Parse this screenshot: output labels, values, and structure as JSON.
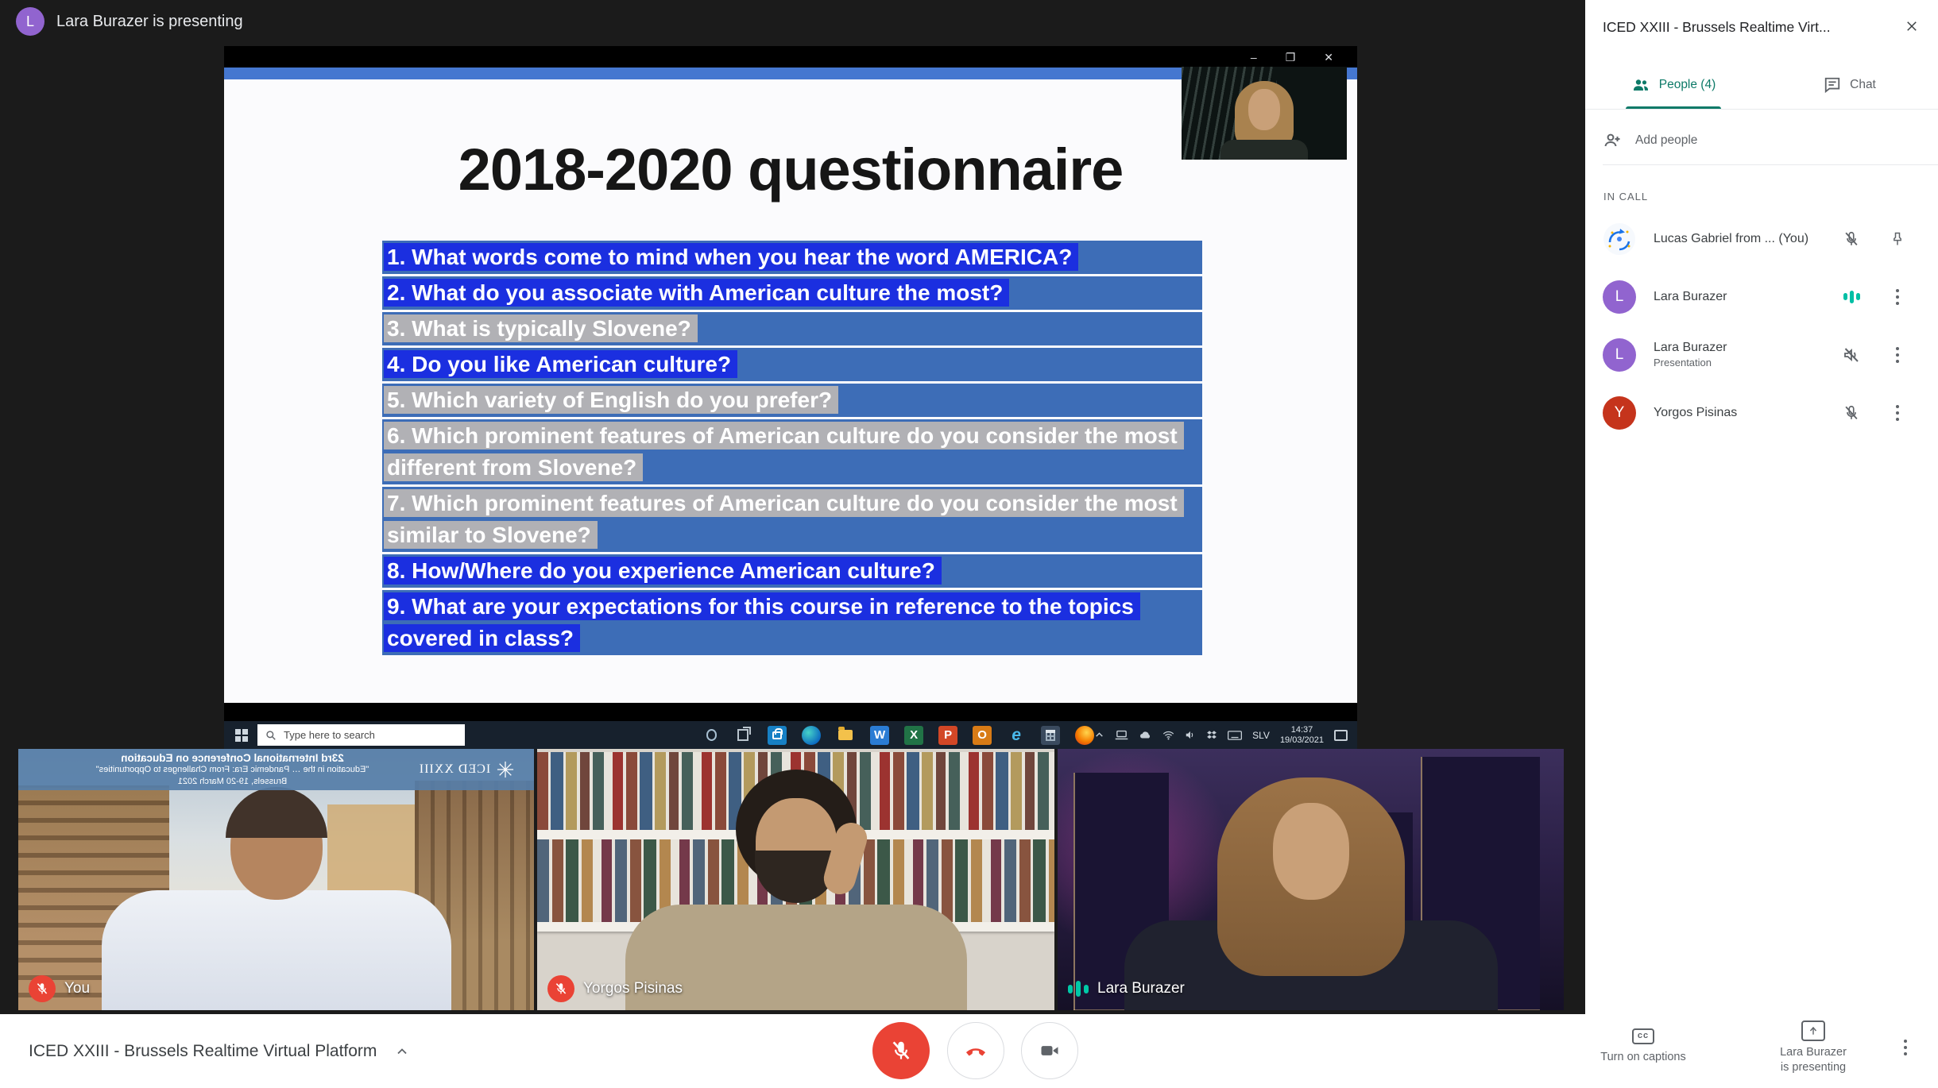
{
  "colors": {
    "meet_teal": "#0d7a68",
    "audio_green": "#00bfa5",
    "meet_red": "#ea4335",
    "avatar_purple": "#9164cf",
    "avatar_red": "#c5341c",
    "slide_bar_blue": "#4577d0",
    "question_base_blue": "#3d6db7",
    "highlight_blue": "#1b2fe0",
    "highlight_gray": "#b1b1b5"
  },
  "top_banner": {
    "avatar_initial": "L",
    "text": "Lara Burazer is presenting"
  },
  "presentation": {
    "window_controls": {
      "minimize": "–",
      "restore": "❐",
      "close": "✕"
    },
    "slide": {
      "title": "2018-2020 questionnaire",
      "questions": [
        {
          "text": "1. What words come to mind when you hear the word AMERICA?",
          "highlight": "blue"
        },
        {
          "text": "2. What do you associate with American culture the most?",
          "highlight": "blue"
        },
        {
          "text": "3. What is typically Slovene?",
          "highlight": "gray"
        },
        {
          "text": "4. Do you like American culture?",
          "highlight": "blue"
        },
        {
          "text": "5. Which variety of English do you prefer?",
          "highlight": "gray"
        },
        {
          "text": "6. Which prominent features of American culture do you consider the most different from Slovene?",
          "highlight": "gray"
        },
        {
          "text": "7. Which prominent features of American culture do you consider the most similar to Slovene?",
          "highlight": "gray"
        },
        {
          "text": "8. How/Where do you experience American culture?",
          "highlight": "blue"
        },
        {
          "text": "9. What are your expectations for this course in reference to the topics covered in class?",
          "highlight": "blue"
        }
      ]
    },
    "taskbar": {
      "search_placeholder": "Type here to search",
      "apps": [
        "microsoft-store",
        "edge",
        "file-explorer",
        "word",
        "excel",
        "powerpoint",
        "outlook",
        "internet-explorer",
        "calculator",
        "firefox"
      ],
      "app_glyphs": {
        "word": "W",
        "excel": "X",
        "powerpoint": "P",
        "outlook": "O",
        "internet_explorer": "e"
      },
      "language": "SLV",
      "time": "14:37",
      "date": "19/03/2021"
    }
  },
  "conference_banner": {
    "line1": "23rd International Conference on Education",
    "line2": "\"Education in the … Pandemic Era: From Challenges to Opportunities\"",
    "line3": "Brussels, 19-20 March 2021",
    "logo": "ICED XXIII"
  },
  "video_tiles": [
    {
      "name": "You",
      "audio": "muted"
    },
    {
      "name": "Yorgos Pisinas",
      "audio": "muted"
    },
    {
      "name": "Lara Burazer",
      "audio": "speaking"
    }
  ],
  "sidebar": {
    "title": "ICED XXIII - Brussels Realtime Virt...",
    "tabs": {
      "people": "People (4)",
      "chat": "Chat"
    },
    "add_people": "Add people",
    "in_call_label": "IN CALL",
    "participants": [
      {
        "name": "Lucas Gabriel from ... (You)",
        "avatar": "logo-image",
        "icons": [
          "mic-off",
          "pin"
        ]
      },
      {
        "name": "Lara Burazer",
        "avatar_initial": "L",
        "icons": [
          "audio-indicator",
          "more-vertical"
        ]
      },
      {
        "name": "Lara Burazer",
        "subtitle": "Presentation",
        "avatar_initial": "L",
        "icons": [
          "volume-off",
          "more-vertical"
        ]
      },
      {
        "name": "Yorgos Pisinas",
        "avatar_initial": "Y",
        "icons": [
          "mic-off",
          "more-vertical"
        ]
      }
    ]
  },
  "bottom_bar": {
    "meeting_title": "ICED XXIII - Brussels Realtime Virtual Platform",
    "captions_icon_label": "cc",
    "captions_label": "Turn on captions",
    "presenting_line1": "Lara Burazer",
    "presenting_line2": "is presenting"
  }
}
